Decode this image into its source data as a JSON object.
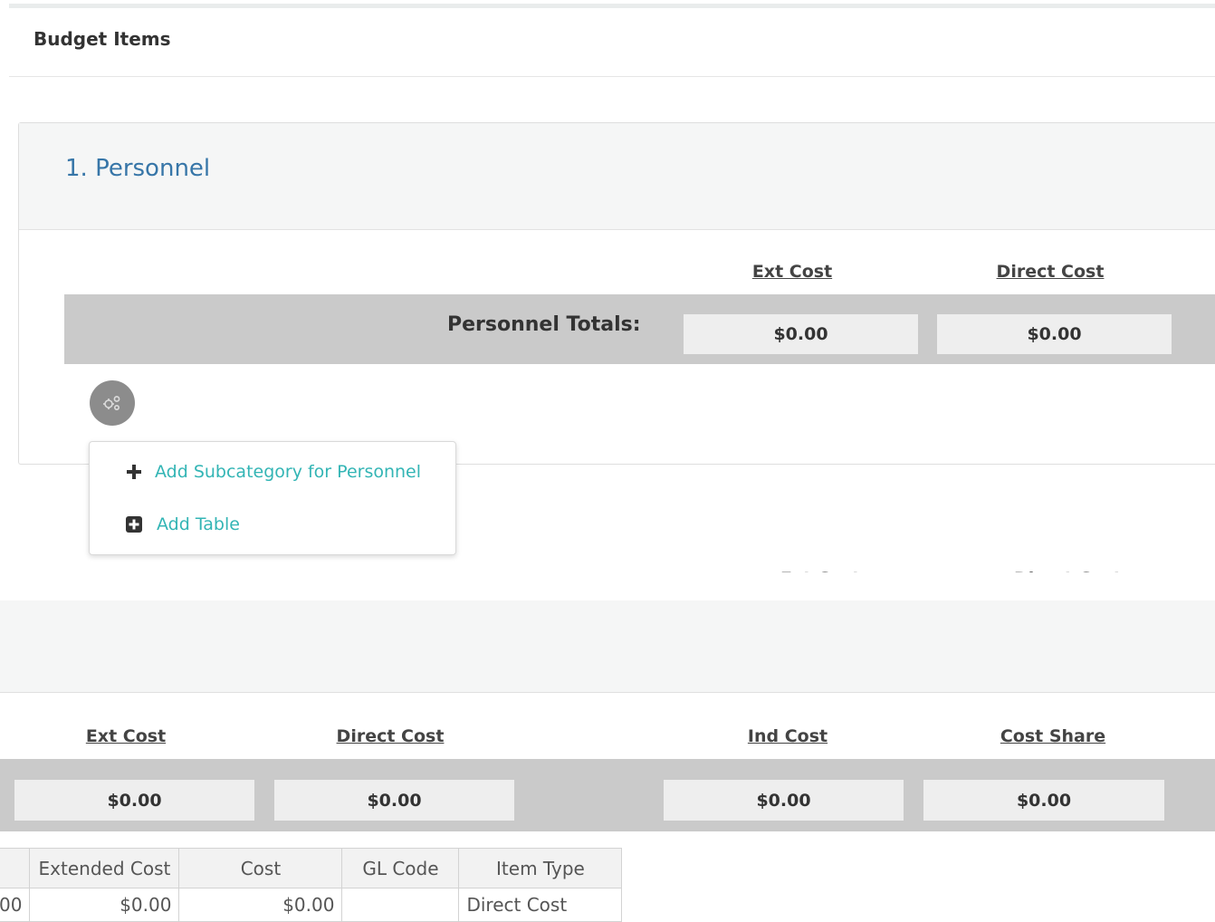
{
  "page": {
    "title": "Budget Items"
  },
  "category": {
    "title": "1. Personnel",
    "col_ext_cost": "Ext Cost",
    "col_direct_cost": "Direct Cost",
    "totals_label": "Personnel Totals:",
    "ext_cost_value": "$0.00",
    "direct_cost_value": "$0.00",
    "gear_icon": "gears-icon",
    "menu": {
      "add_subcategory": "Add Subcategory for Personnel",
      "add_subcategory_icon": "plus-icon",
      "add_table": "Add Table",
      "add_table_icon": "plus-square-icon"
    }
  },
  "background_section": {
    "ghost_ext_cost": "Ext Cost",
    "ghost_direct_cost": "Direct Cost"
  },
  "subcategory": {
    "col_ext_cost": "Ext Cost",
    "col_direct_cost": "Direct Cost",
    "col_ind_cost": "Ind Cost",
    "col_cost_share": "Cost Share",
    "ext_cost_value": "$0.00",
    "direct_cost_value": "$0.00",
    "ind_cost_value": "$0.00",
    "cost_share_value": "$0.00"
  },
  "line_table": {
    "headers": [
      "",
      "Extended Cost",
      "Cost",
      "GL Code",
      "Item Type"
    ],
    "rows": [
      [
        "00",
        "$0.00",
        "$0.00",
        "",
        "Direct Cost"
      ]
    ]
  },
  "colors": {
    "title_blue": "#3776a8",
    "link_teal": "#33b5b5",
    "totals_gray": "#cacaca",
    "value_box_gray": "#eeeeee"
  }
}
